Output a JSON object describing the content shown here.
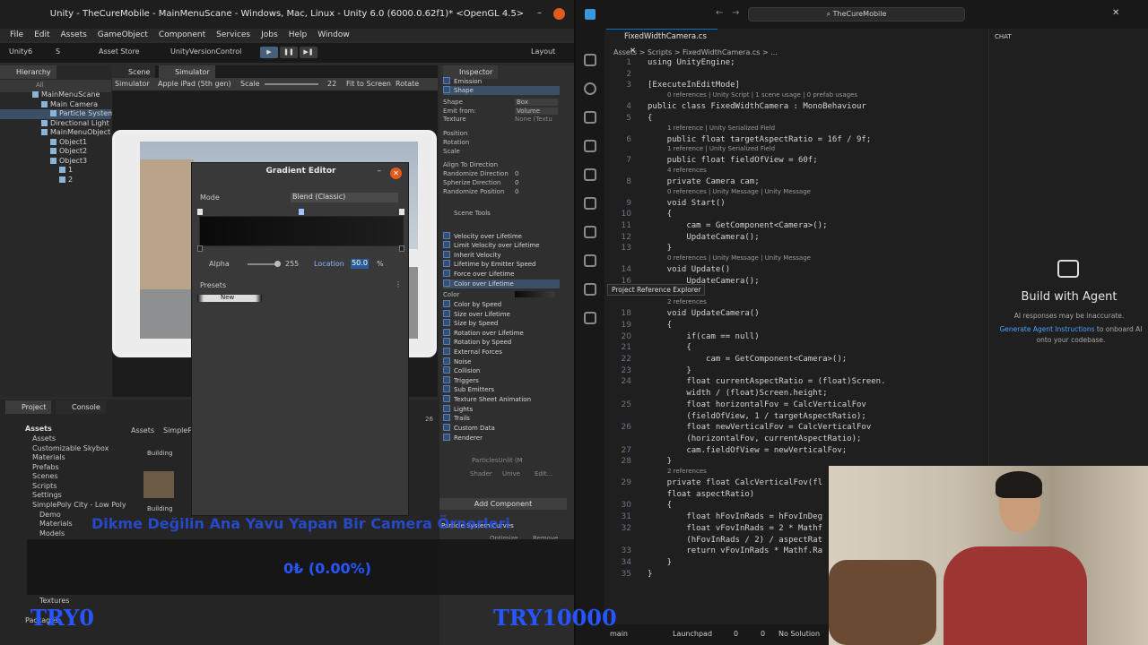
{
  "unity": {
    "title": "Unity - TheCureMobile - MainMenuScane - Windows, Mac, Linux - Unity 6.0 (6000.0.62f1)* <OpenGL 4.5>",
    "menu": [
      "File",
      "Edit",
      "Assets",
      "GameObject",
      "Component",
      "Services",
      "Jobs",
      "Help",
      "Window"
    ],
    "toolbar": {
      "account": "Unity6",
      "s_label": "S",
      "asset_store": "Asset Store",
      "version_control": "UnityVersionControl",
      "layout": "Layout"
    },
    "hierarchy": {
      "tab": "Hierarchy",
      "search_placeholder": "All",
      "items": [
        "MainMenuScane",
        "Main Camera",
        "Particle System",
        "Directional Light",
        "MainMenuObject",
        "Object1",
        "Object2",
        "Object3",
        "1",
        "2"
      ]
    },
    "tabs": {
      "scene": "Scene",
      "simulator": "Simulator"
    },
    "simulator_bar": {
      "mode": "Simulator",
      "device": "Apple iPad (5th gen)",
      "scale_label": "Scale",
      "scale_value": "22",
      "fit": "Fit to Screen",
      "rotate": "Rotate"
    },
    "gradient_editor": {
      "title": "Gradient Editor",
      "mode_label": "Mode",
      "mode_value": "Blend (Classic)",
      "alpha_label": "Alpha",
      "alpha_value": "255",
      "location_label": "Location",
      "location_value": "50.0",
      "location_unit": "%",
      "presets_label": "Presets",
      "preset_new": "New"
    },
    "inspector": {
      "tab": "Inspector",
      "emission": "Emission",
      "shape": "Shape",
      "props": [
        "Shape",
        "Emit from:",
        "Texture",
        "Position",
        "Rotation",
        "Scale",
        "Align To Direction",
        "Randomize Direction",
        "Spherize Direction",
        "Randomize Position"
      ],
      "shape_value": "Box",
      "emit_value": "Volume",
      "texture_value": "None (Textu",
      "zero": "0",
      "scene_tools": "Scene Tools",
      "modules": [
        "Velocity over Lifetime",
        "Limit Velocity over Lifetime",
        "Inherit Velocity",
        "Lifetime by Emitter Speed",
        "Force over Lifetime",
        "Color over Lifetime",
        "Color",
        "Color by Speed",
        "Size over Lifetime",
        "Size by Speed",
        "Rotation over Lifetime",
        "Rotation by Speed",
        "External Forces",
        "Noise",
        "Collision",
        "Triggers",
        "Sub Emitters",
        "Texture Sheet Animation",
        "Lights",
        "Trails",
        "Custom Data",
        "Renderer"
      ],
      "material": "ParticlesUnlit (M",
      "shader_label": "Shader",
      "shader_value": "Unive",
      "edit": "Edit...",
      "add_component": "Add Component",
      "particle_system_curves": "Particle System Curves",
      "optimize": "Optimize",
      "remove": "Remove"
    },
    "project": {
      "tab_project": "Project",
      "tab_console": "Console",
      "count": "26",
      "breadcrumb": [
        "Assets",
        "SimpleP"
      ],
      "tree": [
        "Assets",
        "Assets",
        "Customizable Skybox",
        "Materials",
        "Prefabs",
        "Scenes",
        "Scripts",
        "Settings",
        "SimplePoly City - Low Poly",
        "Demo",
        "Materials",
        "Models",
        "Textures",
        "Packages"
      ],
      "thumbs": [
        "Building",
        "Building"
      ]
    }
  },
  "overlay": {
    "headline": "Dikme Değilin Ana Yavu Yapan Bir Camera Örnerleri",
    "percent": "0₺ (0.00%)",
    "left_tag": "TRY0",
    "right_tag": "TRY10000"
  },
  "vscode": {
    "search": "TheCureMobile",
    "tab": "FixedWidthCamera.cs",
    "breadcrumb": "Assets > Scripts > FixedWidthCamera.cs > ...",
    "chat": {
      "title": "CHAT",
      "heading": "Build with Agent",
      "note": "AI responses may be inaccurate.",
      "link": "Generate Agent Instructions",
      "link_suffix": " to onboard AI onto your codebase."
    },
    "tooltip": "Project Reference Explorer",
    "lines": [
      {
        "n": "1",
        "text": "using UnityEngine;"
      },
      {
        "n": "2",
        "text": ""
      },
      {
        "n": "3",
        "text": "[ExecuteInEditMode]"
      },
      {
        "n": "4",
        "text": "public class FixedWidthCamera : MonoBehaviour"
      },
      {
        "n": "5",
        "text": "{"
      },
      {
        "n": "6",
        "text": "    public float targetAspectRatio = 16f / 9f;"
      },
      {
        "n": "7",
        "text": "    public float fieldOfView = 60f;"
      },
      {
        "n": "8",
        "text": "    private Camera cam;"
      },
      {
        "n": "9",
        "text": "    void Start()"
      },
      {
        "n": "10",
        "text": "    {"
      },
      {
        "n": "11",
        "text": "        cam = GetComponent<Camera>();"
      },
      {
        "n": "12",
        "text": "        UpdateCamera();"
      },
      {
        "n": "13",
        "text": "    }"
      },
      {
        "n": "14",
        "text": "    void Update()"
      },
      {
        "n": "16",
        "text": "        UpdateCamera();"
      },
      {
        "n": "17",
        "text": "    }"
      },
      {
        "n": "18",
        "text": "    void UpdateCamera()"
      },
      {
        "n": "19",
        "text": "    {"
      },
      {
        "n": "20",
        "text": "        if(cam == null)"
      },
      {
        "n": "21",
        "text": "        {"
      },
      {
        "n": "22",
        "text": "            cam = GetComponent<Camera>();"
      },
      {
        "n": "23",
        "text": "        }"
      },
      {
        "n": "24",
        "text": "        float currentAspectRatio = (float)Screen."
      },
      {
        "n": "",
        "text": "        width / (float)Screen.height;"
      },
      {
        "n": "25",
        "text": "        float horizontalFov = CalcVerticalFov"
      },
      {
        "n": "",
        "text": "        (fieldOfView, 1 / targetAspectRatio);"
      },
      {
        "n": "26",
        "text": "        float newVerticalFov = CalcVerticalFov"
      },
      {
        "n": "",
        "text": "        (horizontalFov, currentAspectRatio);"
      },
      {
        "n": "27",
        "text": "        cam.fieldOfView = newVerticalFov;"
      },
      {
        "n": "28",
        "text": "    }"
      },
      {
        "n": "29",
        "text": "    private float CalcVerticalFov(fl"
      },
      {
        "n": "",
        "text": "    float aspectRatio)"
      },
      {
        "n": "30",
        "text": "    {"
      },
      {
        "n": "31",
        "text": "        float hFovInRads = hFovInDeg"
      },
      {
        "n": "32",
        "text": "        float vFovInRads = 2 * Mathf"
      },
      {
        "n": "",
        "text": "        (hFovInRads / 2) / aspectRat"
      },
      {
        "n": "33",
        "text": "        return vFovInRads * Mathf.Ra"
      },
      {
        "n": "34",
        "text": "    }"
      },
      {
        "n": "35",
        "text": "}"
      }
    ],
    "lenses": [
      "0 references | Unity Script | 1 scene usage | 0 prefab usages",
      "1 reference | Unity Serialized Field",
      "1 reference | Unity Serialized Field",
      "4 references",
      "0 references | Unity Message | Unity Message",
      "0 references | Unity Message | Unity Message",
      "2 references",
      "2 references"
    ],
    "status": {
      "branch": "main",
      "launchpad": "Launchpad",
      "errors": "0",
      "warnings": "0",
      "solution": "No Solution"
    }
  }
}
